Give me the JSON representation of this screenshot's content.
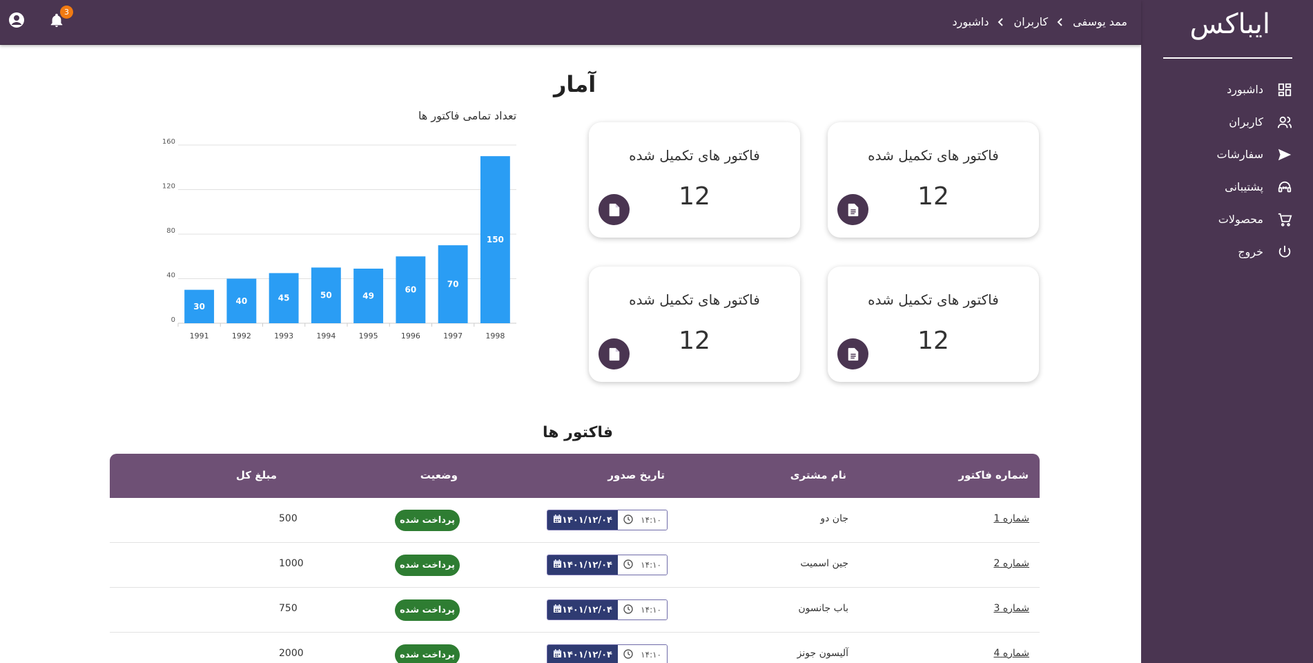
{
  "app": {
    "brand": "ایباکس"
  },
  "sidebar": {
    "items": [
      {
        "label": "داشبورد",
        "icon": "dashboard-icon"
      },
      {
        "label": "کاربران",
        "icon": "users-icon"
      },
      {
        "label": "سفارشات",
        "icon": "send-icon"
      },
      {
        "label": "پشتیبانی",
        "icon": "headset-icon"
      },
      {
        "label": "محصولات",
        "icon": "cart-icon"
      },
      {
        "label": "خروج",
        "icon": "power-icon"
      }
    ]
  },
  "header": {
    "notifications_count": "3",
    "breadcrumb": [
      "داشبورد",
      "کاربران",
      "ممد یوسفی"
    ]
  },
  "stats": {
    "title": "آمار",
    "cards": [
      {
        "title": "فاکتور های تکمیل شده",
        "value": "12",
        "icon": "file-text-icon"
      },
      {
        "title": "فاکتور های تکمیل شده",
        "value": "12",
        "icon": "file-icon"
      },
      {
        "title": "فاکتور های تکمیل شده",
        "value": "12",
        "icon": "file-text-icon"
      },
      {
        "title": "فاکتور های تکمیل شده",
        "value": "12",
        "icon": "file-icon"
      }
    ]
  },
  "chart_data": {
    "type": "bar",
    "title": "تعداد تمامی فاکتور ها",
    "categories": [
      "1991",
      "1992",
      "1993",
      "1994",
      "1995",
      "1996",
      "1997",
      "1998"
    ],
    "values": [
      30,
      40,
      45,
      50,
      49,
      60,
      70,
      150
    ],
    "yticks": [
      0,
      40,
      80,
      120,
      160
    ],
    "ylim": [
      0,
      160
    ],
    "color": "#2a9df4",
    "grid": true
  },
  "invoices": {
    "title": "فاکتور ها",
    "columns": {
      "number": "شماره فاکتور",
      "customer": "نام مشتری",
      "date": "تاریخ صدور",
      "status": "وضعیت",
      "total": "مبلغ کل"
    },
    "rows": [
      {
        "prefix": "شماره",
        "num": "1",
        "customer": "جان دو",
        "time": "۱۴:۱۰",
        "date": "۱۴۰۱/۱۲/۰۴",
        "status": "پرداخت شده",
        "total": "500"
      },
      {
        "prefix": "شماره",
        "num": "2",
        "customer": "جین اسمیت",
        "time": "۱۴:۱۰",
        "date": "۱۴۰۱/۱۲/۰۴",
        "status": "پرداخت شده",
        "total": "1000"
      },
      {
        "prefix": "شماره",
        "num": "3",
        "customer": "باب جانسون",
        "time": "۱۴:۱۰",
        "date": "۱۴۰۱/۱۲/۰۴",
        "status": "پرداخت شده",
        "total": "750"
      },
      {
        "prefix": "شماره",
        "num": "4",
        "customer": "آلیسون جونز",
        "time": "۱۴:۱۰",
        "date": "۱۴۰۱/۱۲/۰۴",
        "status": "پرداخت شده",
        "total": "2000"
      }
    ]
  },
  "colors": {
    "primary": "#4a3551",
    "table_header": "#6e5075",
    "status_paid": "#2e7d32",
    "date_chip": "#2f3b72",
    "badge": "#f07a12"
  }
}
